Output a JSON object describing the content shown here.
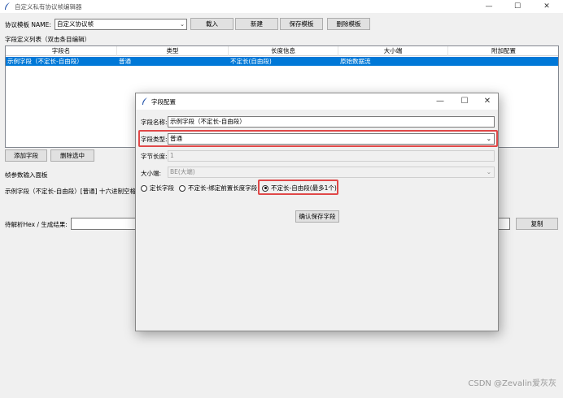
{
  "window": {
    "title": "自定义私有协议帧编辑器",
    "controls": {
      "minimize": "—",
      "maximize": "☐",
      "close": "✕"
    }
  },
  "toolbar": {
    "template_label": "协议模板 NAME:",
    "template_value": "自定义协议帧",
    "load_button": "载入",
    "new_button": "新建",
    "save_template_button": "保存模板",
    "delete_template_button": "删除模板"
  },
  "fields_table": {
    "caption": "字段定义列表（双击条目编辑）",
    "columns": [
      "字段名",
      "类型",
      "长度信息",
      "大小端",
      "附加配置"
    ],
    "rows": [
      [
        "示例字段（不定长-自由段）",
        "普通",
        "不定长(自由段)",
        "原始数据流",
        ""
      ]
    ]
  },
  "actions": {
    "add_field": "添加字段",
    "delete_selected": "删除选中"
  },
  "frame_panel": {
    "title": "帧参数输入面板",
    "field_row_text": "示例字段（不定长-自由段）[普通] 十六进制空格"
  },
  "parse": {
    "label": "待解析Hex / 生成结果:",
    "copy_button": "复制"
  },
  "dialog": {
    "title": "字段配置",
    "controls": {
      "minimize": "—",
      "maximize": "☐",
      "close": "✕"
    },
    "field_name_label": "字段名称:",
    "field_name_value": "示例字段（不定长-自由段）",
    "field_type_label": "字段类型:",
    "field_type_value": "普通",
    "byte_length_label": "字节长度:",
    "byte_length_value": "1",
    "endian_label": "大小端:",
    "endian_value": "BE(大端)",
    "radios": [
      {
        "label": "定长字段",
        "checked": false
      },
      {
        "label": "不定长-绑定前置长度字段",
        "checked": false
      },
      {
        "label": "不定长-自由段(最多1个)",
        "checked": true
      }
    ],
    "confirm_button": "确认保存字段"
  },
  "watermark": "CSDN @Zevalin爱灰灰",
  "colors": {
    "selection": "#0078d7",
    "highlight_box": "#e04848",
    "background": "#f0f0f0"
  },
  "icons": [
    "feather-icon",
    "chevron-down-icon",
    "minimize-icon",
    "maximize-icon",
    "close-icon",
    "radio-icon"
  ]
}
